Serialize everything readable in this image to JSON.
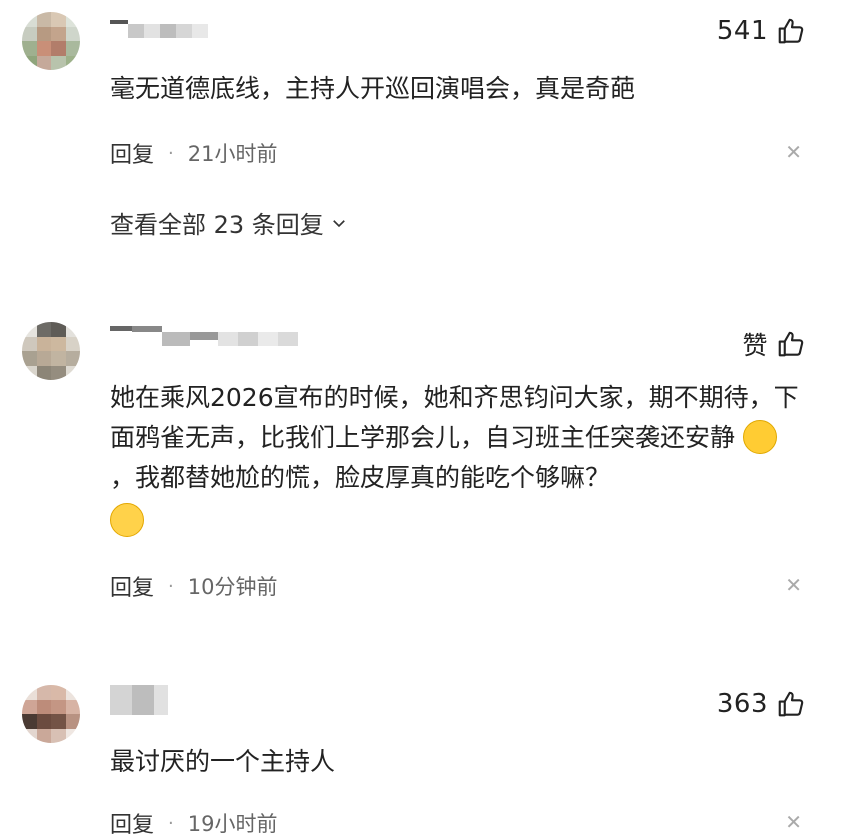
{
  "comments": [
    {
      "like_count": "541",
      "text": "毫无道德底线，主持人开巡回演唱会，真是奇葩",
      "reply_label": "回复",
      "separator": "·",
      "time": "21小时前",
      "view_replies": "查看全部 23 条回复"
    },
    {
      "like_count": "赞",
      "text_part1": "她在乘风2026宣布的时候，她和齐思钧问大家，期不期待，下面鸦雀无声，比我们上学那会儿，自习班主任突袭还安静",
      "text_part2": "，我都替她尬的慌，脸皮厚真的能吃个够嘛？",
      "reply_label": "回复",
      "separator": "·",
      "time": "10分钟前"
    },
    {
      "like_count": "363",
      "text": "最讨厌的一个主持人",
      "reply_label": "回复",
      "separator": "·",
      "time": "19小时前"
    }
  ],
  "icons": {
    "thumb": "thumbs-up-icon",
    "close": "close-icon",
    "chevron": "chevron-down-icon",
    "laugh_emoji": "laughing-crying-emoji-icon",
    "grin_emoji": "grinning-emoji-icon"
  },
  "colors": {
    "text": "#222222",
    "meta": "#666666",
    "close": "#aaaaaa"
  }
}
